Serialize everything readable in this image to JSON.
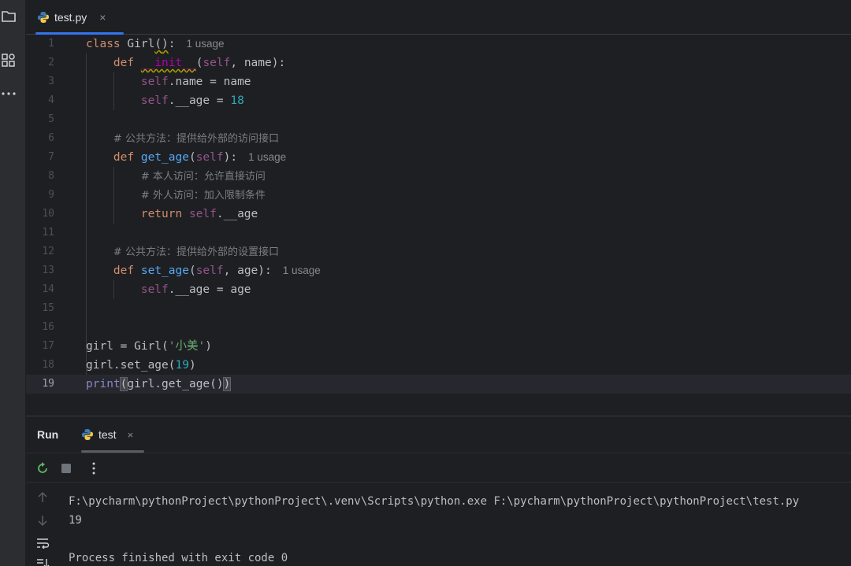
{
  "editor": {
    "tab": {
      "filename": "test.py",
      "close": "×"
    },
    "lines": [
      {
        "n": "1"
      },
      {
        "n": "2"
      },
      {
        "n": "3"
      },
      {
        "n": "4"
      },
      {
        "n": "5"
      },
      {
        "n": "6"
      },
      {
        "n": "7"
      },
      {
        "n": "8"
      },
      {
        "n": "9"
      },
      {
        "n": "10"
      },
      {
        "n": "11"
      },
      {
        "n": "12"
      },
      {
        "n": "13"
      },
      {
        "n": "14"
      },
      {
        "n": "15"
      },
      {
        "n": "16"
      },
      {
        "n": "17"
      },
      {
        "n": "18"
      },
      {
        "n": "19"
      }
    ],
    "tokens": {
      "class_kw": "class",
      "class_name": " Girl",
      "class_paren_open": "(",
      "class_paren_close": ")",
      "class_colon": ":",
      "usage_hint": "1 usage",
      "def_kw": "def",
      "init_name": "__init__",
      "init_params_open": "(",
      "self": "self",
      "init_params_rest": ", name):",
      "name_attr": ".name = name",
      "age_attr": ".__age = ",
      "age_value": "18",
      "comment_get": "# 公共方法：提供给外部的访问接口",
      "get_age_name": "get_age",
      "get_age_params_open": "(",
      "get_age_params_close": "):",
      "comment_self_access": "# 本人访问：允许直接访问",
      "comment_outside_access": "# 外人访问：加入限制条件",
      "return_kw": "return",
      "return_rest": ".__age",
      "comment_set": "# 公共方法：提供给外部的设置接口",
      "set_age_name": "set_age",
      "set_age_params_open": "(",
      "set_age_params_rest": ", age):",
      "set_age_body": ".__age = age",
      "girl_assign": "girl = Girl(",
      "girl_str": "'小美'",
      "girl_close": ")",
      "set_call": "girl.set_age(",
      "set_call_value": "19",
      "set_call_close": ")",
      "print_fn": "print",
      "print_open": "(",
      "print_inner": "girl.get_age()",
      "print_close": ")"
    }
  },
  "run": {
    "title": "Run",
    "tab_name": "test",
    "tab_close": "×",
    "output": [
      "F:\\pycharm\\pythonProject\\pythonProject\\.venv\\Scripts\\python.exe F:\\pycharm\\pythonProject\\pythonProject\\test.py",
      "19",
      "",
      "Process finished with exit code 0"
    ]
  }
}
